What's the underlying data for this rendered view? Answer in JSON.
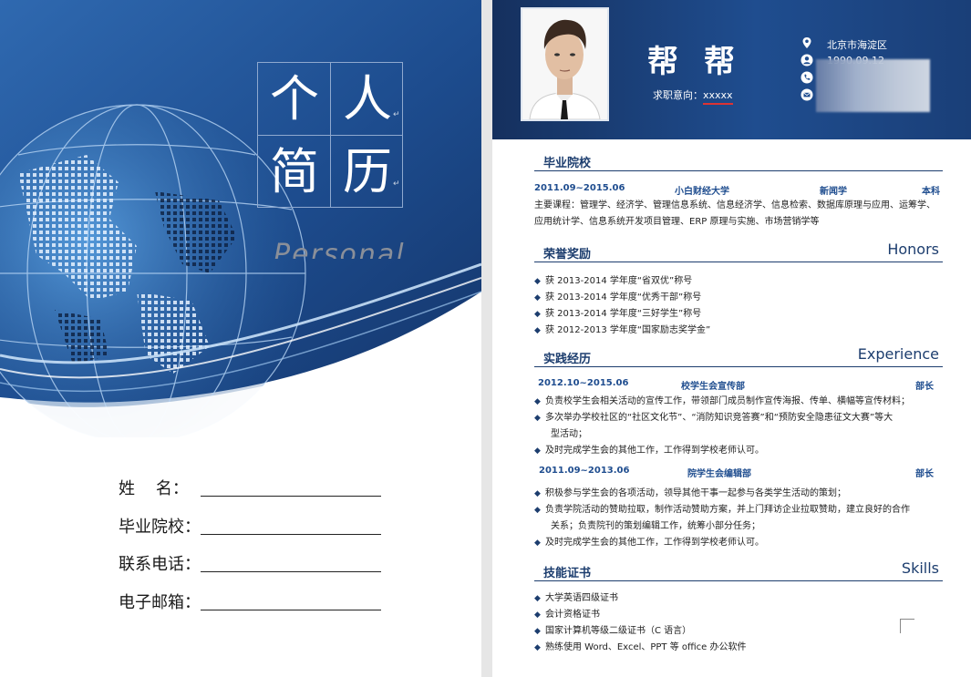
{
  "cover": {
    "title_chars": [
      "个",
      "人",
      "简",
      "历"
    ],
    "personal_text": "Personal",
    "fields": [
      {
        "label": "姓    名："
      },
      {
        "label": "毕业院校："
      },
      {
        "label": "联系电话："
      },
      {
        "label": "电子邮箱："
      }
    ]
  },
  "resume": {
    "name": "帮帮",
    "objective_label": "求职意向：",
    "objective_value": "xxxxx",
    "contact": {
      "address": "北京市海淀区",
      "birthday": "1990.09.12"
    },
    "education": {
      "title_cn": "毕业院校",
      "period": "2011.09~2015.06",
      "school": "小白财经大学",
      "major": "新闻学",
      "degree": "本科",
      "courses_line1": "主要课程：管理学、经济学、管理信息系统、信息经济学、信息检索、数据库原理与应用、运筹学、",
      "courses_line2": "应用统计学、信息系统开发项目管理、ERP 原理与实施、市场营销学等"
    },
    "honors": {
      "title_cn": "荣誉奖励",
      "title_en": "Honors",
      "items": [
        "获 2013-2014 学年度“省双优”称号",
        "获 2013-2014 学年度“优秀干部”称号",
        "获 2013-2014 学年度“三好学生”称号",
        "获 2012-2013 学年度“国家励志奖学金”"
      ]
    },
    "experience": {
      "title_cn": "实践经历",
      "title_en": "Experience",
      "jobs": [
        {
          "period": "2012.10~2015.06",
          "org": "校学生会宣传部",
          "role": "部长",
          "items": [
            [
              "负责校学生会相关活动的宣传工作，带领部门成员制作宣传海报、传单、横幅等宣传材料；"
            ],
            [
              "多次举办学校社区的“社区文化节”、“消防知识竞答赛”和“预防安全隐患征文大赛”等大",
              "型活动；"
            ],
            [
              "及时完成学生会的其他工作，工作得到学校老师认可。"
            ]
          ]
        },
        {
          "period": "2011.09~2013.06",
          "org": "院学生会编辑部",
          "role": "部长",
          "items": [
            [
              "积极参与学生会的各项活动，领导其他干事一起参与各类学生活动的策划；"
            ],
            [
              "负责学院活动的赞助拉取，制作活动赞助方案，并上门拜访企业拉取赞助，建立良好的合作",
              "关系；负责院刊的策划编辑工作，统筹小部分任务；"
            ],
            [
              "及时完成学生会的其他工作，工作得到学校老师认可。"
            ]
          ]
        }
      ]
    },
    "skills": {
      "title_cn": "技能证书",
      "title_en": "Skills",
      "items": [
        "大学英语四级证书",
        "会计资格证书",
        "国家计算机等级二级证书（C 语言）",
        "熟练使用 Word、Excel、PPT 等 office 办公软件"
      ]
    }
  }
}
